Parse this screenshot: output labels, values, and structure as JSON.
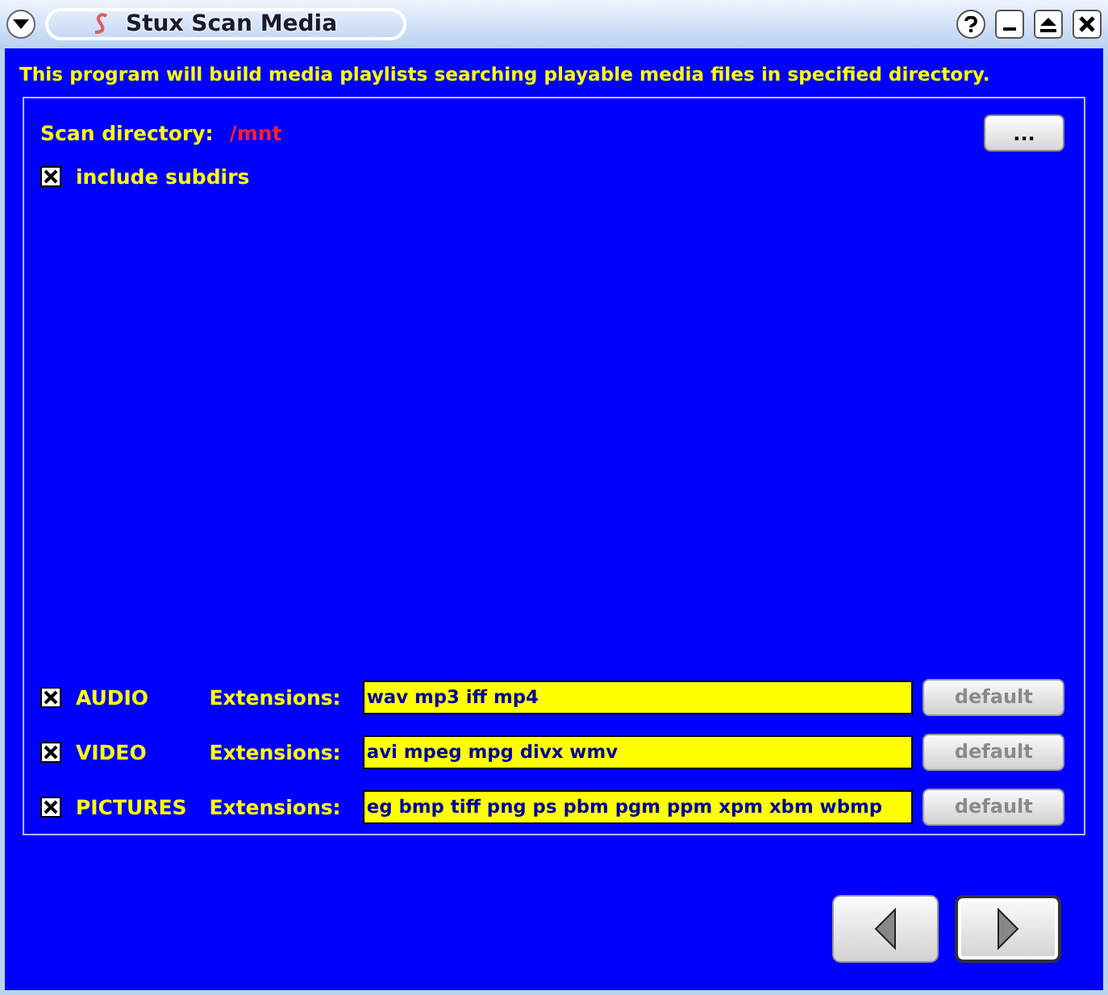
{
  "window": {
    "title": "Stux Scan Media"
  },
  "description": "This program will build media playlists searching playable media files in specified directory.",
  "scan_directory": {
    "label": "Scan directory:",
    "value": "/mnt",
    "browse_button": "..."
  },
  "include_subdirs": {
    "label": "include subdirs",
    "checked": true
  },
  "media_types": [
    {
      "label": "AUDIO",
      "checked": true,
      "extensions_label": "Extensions:",
      "value": "wav mp3 iff mp4",
      "default_button": "default",
      "disabled": true
    },
    {
      "label": "VIDEO",
      "checked": true,
      "extensions_label": "Extensions:",
      "value": "avi mpeg mpg divx wmv",
      "default_button": "default",
      "disabled": true
    },
    {
      "label": "PICTURES",
      "checked": true,
      "extensions_label": "Extensions:",
      "value": "eg bmp tiff png ps pbm pgm ppm xpm xbm wbmp",
      "default_button": "default",
      "disabled": true
    }
  ],
  "navigation": [
    {
      "kind": "back",
      "focused": false
    },
    {
      "kind": "next",
      "focused": true
    }
  ]
}
